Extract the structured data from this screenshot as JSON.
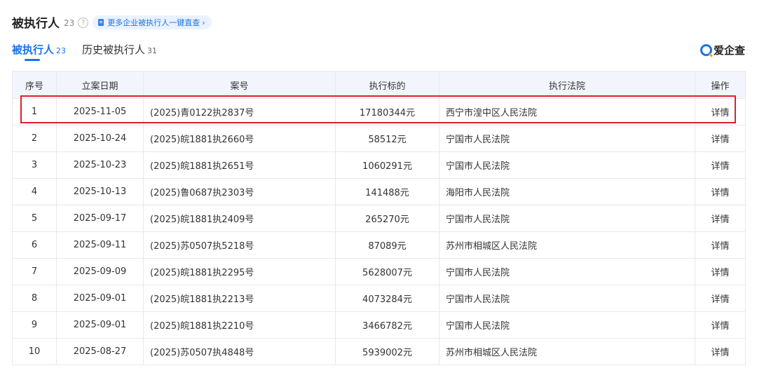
{
  "header": {
    "title": "被执行人",
    "count": "23",
    "help_icon": "?",
    "more_link": "更多企业被执行人一键直查",
    "more_chevron": "›"
  },
  "tabs": [
    {
      "label": "被执行人",
      "count": "23"
    },
    {
      "label": "历史被执行人",
      "count": "31"
    }
  ],
  "logo": {
    "text": "爱企查"
  },
  "accent_color": "#1a73e8",
  "highlight_color": "#e0202a",
  "table": {
    "columns": [
      "序号",
      "立案日期",
      "案号",
      "执行标的",
      "执行法院",
      "操作"
    ],
    "rows": [
      {
        "index": "1",
        "date": "2025-11-05",
        "case_no": "(2025)青0122执2837号",
        "amount": "17180344元",
        "court": "西宁市湟中区人民法院",
        "action": "详情"
      },
      {
        "index": "2",
        "date": "2025-10-24",
        "case_no": "(2025)皖1881执2660号",
        "amount": "58512元",
        "court": "宁国市人民法院",
        "action": "详情"
      },
      {
        "index": "3",
        "date": "2025-10-23",
        "case_no": "(2025)皖1881执2651号",
        "amount": "1060291元",
        "court": "宁国市人民法院",
        "action": "详情"
      },
      {
        "index": "4",
        "date": "2025-10-13",
        "case_no": "(2025)鲁0687执2303号",
        "amount": "141488元",
        "court": "海阳市人民法院",
        "action": "详情"
      },
      {
        "index": "5",
        "date": "2025-09-17",
        "case_no": "(2025)皖1881执2409号",
        "amount": "265270元",
        "court": "宁国市人民法院",
        "action": "详情"
      },
      {
        "index": "6",
        "date": "2025-09-11",
        "case_no": "(2025)苏0507执5218号",
        "amount": "87089元",
        "court": "苏州市相城区人民法院",
        "action": "详情"
      },
      {
        "index": "7",
        "date": "2025-09-09",
        "case_no": "(2025)皖1881执2295号",
        "amount": "5628007元",
        "court": "宁国市人民法院",
        "action": "详情"
      },
      {
        "index": "8",
        "date": "2025-09-01",
        "case_no": "(2025)皖1881执2213号",
        "amount": "4073284元",
        "court": "宁国市人民法院",
        "action": "详情"
      },
      {
        "index": "9",
        "date": "2025-09-01",
        "case_no": "(2025)皖1881执2210号",
        "amount": "3466782元",
        "court": "宁国市人民法院",
        "action": "详情"
      },
      {
        "index": "10",
        "date": "2025-08-27",
        "case_no": "(2025)苏0507执4848号",
        "amount": "5939002元",
        "court": "苏州市相城区人民法院",
        "action": "详情"
      }
    ]
  }
}
